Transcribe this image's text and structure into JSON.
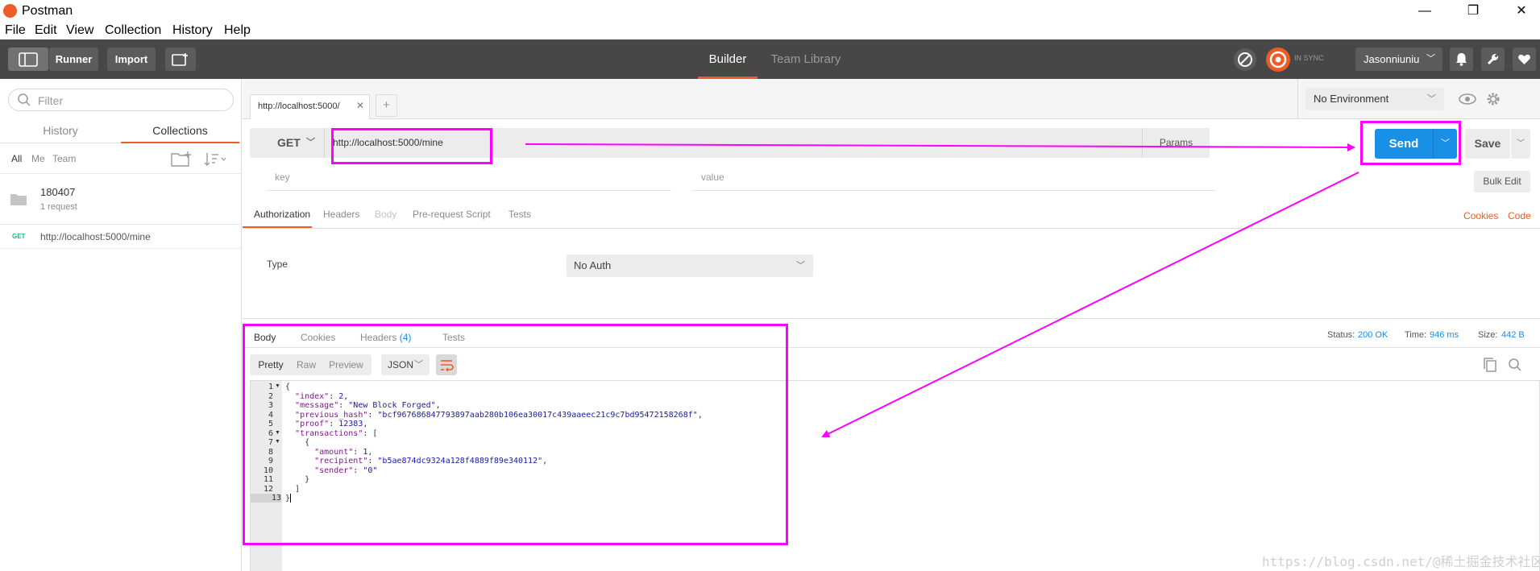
{
  "app": {
    "title": "Postman"
  },
  "window_controls": {
    "minimize": "—",
    "maximize": "❐",
    "close": "✕"
  },
  "menu": [
    "File",
    "Edit",
    "View",
    "Collection",
    "History",
    "Help"
  ],
  "header": {
    "runner": "Runner",
    "import": "Import",
    "nav_builder": "Builder",
    "nav_team_library": "Team Library",
    "sync_status": "IN SYNC",
    "user": "Jasonniuniu"
  },
  "sidebar": {
    "filter_placeholder": "Filter",
    "tabs": [
      "History",
      "Collections"
    ],
    "active_tab": "Collections",
    "subtabs": [
      "All",
      "Me",
      "Team"
    ],
    "collection": {
      "name": "180407",
      "count": "1 request"
    },
    "history_item": {
      "method": "GET",
      "url": "http://localhost:5000/mine"
    }
  },
  "request": {
    "tab_label": "http://localhost:5000/",
    "new_tab": "+",
    "environment": "No Environment",
    "method": "GET",
    "url": "http://localhost:5000/mine",
    "params": "Params",
    "send": "Send",
    "save": "Save",
    "key_placeholder": "key",
    "value_placeholder": "value",
    "bulk_edit": "Bulk Edit",
    "subtabs": [
      "Authorization",
      "Headers",
      "Body",
      "Pre-request Script",
      "Tests"
    ],
    "cookies_link": "Cookies",
    "code_link": "Code",
    "auth_type_label": "Type",
    "auth_type_value": "No Auth"
  },
  "response": {
    "tabs": [
      "Body",
      "Cookies",
      "Headers",
      "Tests"
    ],
    "headers_count": "(4)",
    "status_label": "Status:",
    "status_value": "200 OK",
    "time_label": "Time:",
    "time_value": "946 ms",
    "size_label": "Size:",
    "size_value": "442 B",
    "view_modes": [
      "Pretty",
      "Raw",
      "Preview"
    ],
    "format": "JSON",
    "line_numbers": [
      "1",
      "2",
      "3",
      "4",
      "5",
      "6",
      "7",
      "8",
      "9",
      "10",
      "11",
      "12",
      "13"
    ],
    "code": {
      "l1": "{",
      "l2_key": "\"index\"",
      "l2_val": "2",
      "l3_key": "\"message\"",
      "l3_val": "\"New Block Forged\"",
      "l4_key": "\"previous_hash\"",
      "l4_val": "\"bcf967686847793897aab280b106ea30017c439aaeec21c9c7bd95472158268f\"",
      "l5_key": "\"proof\"",
      "l5_val": "12383",
      "l6_key": "\"transactions\"",
      "l6_open": "[",
      "l7": "{",
      "l8_key": "\"amount\"",
      "l8_val": "1",
      "l9_key": "\"recipient\"",
      "l9_val": "\"b5ae874dc9324a128f4889f89e340112\"",
      "l10_key": "\"sender\"",
      "l10_val": "\"0\"",
      "l11": "}",
      "l12": "]",
      "l13": "}"
    }
  },
  "watermark": "https://blog.csdn.net/@稀土掘金技术社区",
  "colors": {
    "accent": "#ef5b25",
    "send": "#1a8fe6",
    "annotation": "#ff00ff",
    "header_bg": "#474747"
  }
}
